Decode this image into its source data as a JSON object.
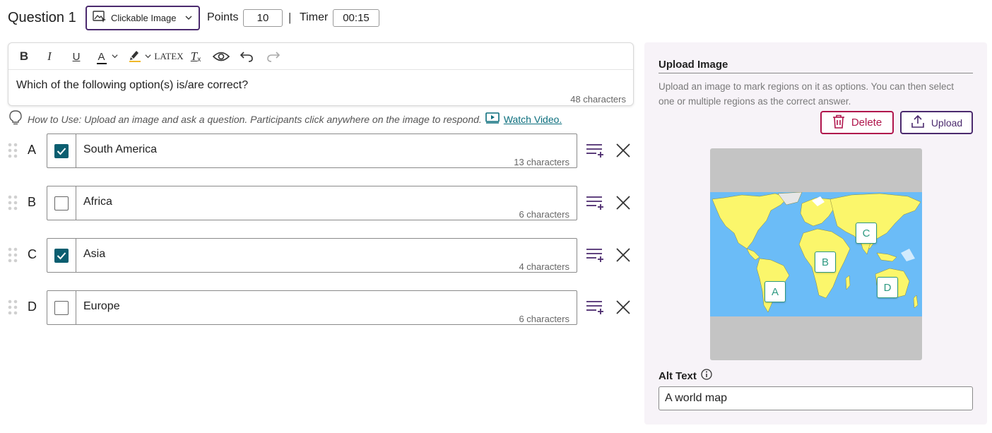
{
  "header": {
    "question_title": "Question 1",
    "question_type": "Clickable Image",
    "points_label": "Points",
    "points_value": "10",
    "separator": "|",
    "timer_label": "Timer",
    "timer_value": "00:15"
  },
  "editor": {
    "toolbar": {
      "bold": "B",
      "italic": "I",
      "underline": "U",
      "text_color": "A",
      "latex": "LATEX",
      "clear_format": "T"
    },
    "text": "Which of the following option(s) is/are correct?",
    "char_count": "48 characters"
  },
  "hint": {
    "text": "How to Use: Upload an image and ask a question. Participants click anywhere on the image to respond.",
    "link_text": "Watch Video."
  },
  "options": [
    {
      "letter": "A",
      "text": "South America",
      "checked": true,
      "char_count": "13 characters"
    },
    {
      "letter": "B",
      "text": "Africa",
      "checked": false,
      "char_count": "6 characters"
    },
    {
      "letter": "C",
      "text": "Asia",
      "checked": true,
      "char_count": "4 characters"
    },
    {
      "letter": "D",
      "text": "Europe",
      "checked": false,
      "char_count": "6 characters"
    }
  ],
  "panel": {
    "title": "Upload Image",
    "description": "Upload an image to mark regions on it as options. You can then select one or multiple regions as the correct answer.",
    "delete_label": "Delete",
    "upload_label": "Upload",
    "map_markers": [
      "A",
      "B",
      "C",
      "D"
    ],
    "alt_text_label": "Alt Text",
    "alt_text_value": "A world map"
  },
  "colors": {
    "accent_purple": "#4b2a6e",
    "delete_red": "#b0154c",
    "checkbox_teal": "#0b5e70",
    "link_teal": "#0b6e7d",
    "map_land": "#fbf66b",
    "map_ocean": "#6bbcf7",
    "panel_bg": "#f7f3f8"
  }
}
